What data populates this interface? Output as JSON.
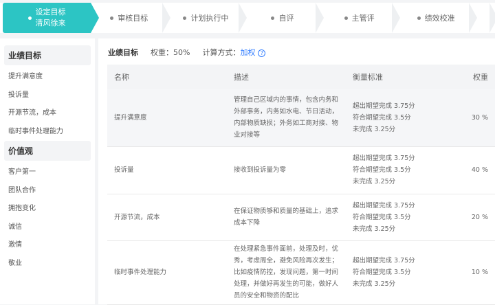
{
  "steps": [
    {
      "label": "设定目标",
      "sub": "清风徐来",
      "active": true
    },
    {
      "label": "审核目标"
    },
    {
      "label": "计划执行中"
    },
    {
      "label": "自评"
    },
    {
      "label": "主管评"
    },
    {
      "label": "绩效校准"
    }
  ],
  "sidebar": {
    "groups": [
      {
        "title": "业绩目标",
        "items": [
          "提升满意度",
          "投诉量",
          "开源节流，成本",
          "临时事件处理能力"
        ]
      },
      {
        "title": "价值观",
        "items": [
          "客户第一",
          "团队合作",
          "拥抱变化",
          "诚信",
          "激情",
          "敬业"
        ]
      }
    ]
  },
  "header": {
    "title": "业绩目标",
    "weight": "权重：50%",
    "calc_label": "计算方式：",
    "calc_value": "加权",
    "help_icon": "?"
  },
  "table": {
    "columns": [
      "名称",
      "描述",
      "衡量标准",
      "权重"
    ],
    "rows": [
      {
        "name": "提升满意度",
        "desc": "管理自己区域内的事情，包含内务和外部事务，内务如水电、节日活动，内部物质缺损；外务如工商对接、物业对接等",
        "std": [
          "超出期望完成 3.75分",
          "符合期望完成 3.5分",
          "未完成 3.25分"
        ],
        "weight": "30 %"
      },
      {
        "name": "投诉量",
        "desc": "接收到投诉量为零",
        "std": [
          "超出期望完成 3.75分",
          "符合期望完成 3.5分",
          "未完成 3.25分"
        ],
        "weight": "40 %"
      },
      {
        "name": "开源节流，成本",
        "desc": "在保证物质够和质量的基础上，追求成本下降",
        "std": [
          "超出期望完成 3.75分",
          "符合期望完成 3.5分",
          "未完成 3.25分"
        ],
        "weight": "20 %"
      },
      {
        "name": "临时事件处理能力",
        "desc": "在处理紧急事件面前，处理及时，优秀，考虑周全，避免风险再次发生；比如疫情防控，发现问题，第一时间处理，并做好再发生的可能，做好人员的安全和物资的配比",
        "std": [
          "超出期望完成 3.75分",
          "符合期望完成 3.5分",
          "未完成 3.25分"
        ],
        "weight": "10 %"
      }
    ]
  }
}
